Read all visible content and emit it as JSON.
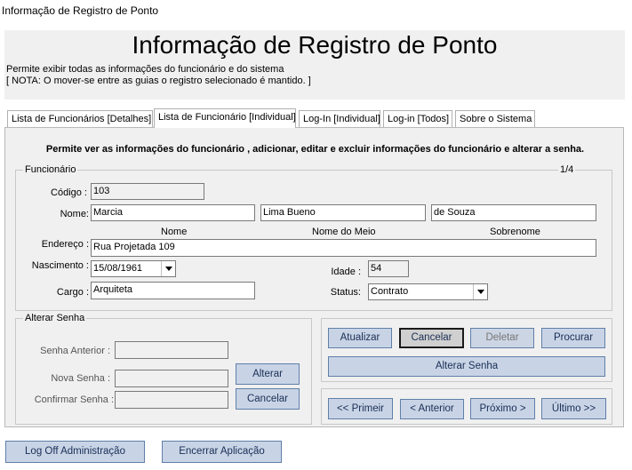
{
  "window": {
    "title": "Informação de Registro de Ponto"
  },
  "header": {
    "title": "Informação de Registro de Ponto",
    "line1": "Permite exibir todas as informações do funcionário e do sistema",
    "line2": "[ NOTA: O mover-se entre as guias o registro selecionado é mantido. ]"
  },
  "tabs": [
    {
      "label": "Lista de Funcionários [Detalhes]"
    },
    {
      "label": "Lista de Funcionário [Individual]"
    },
    {
      "label": "Log-In [Individual]"
    },
    {
      "label": "Log-in [Todos]"
    },
    {
      "label": "Sobre o Sistema"
    }
  ],
  "panel": {
    "intro": "Permite ver as informações do funcionário , adicionar, editar e excluir informações do funcionário e alterar a senha."
  },
  "employee": {
    "legend": "Funcionário",
    "counter": "1/4",
    "code_label": "Código :",
    "code": "103",
    "name_label": "Nome:",
    "first_name": "Marcia",
    "middle_name": "Lima Bueno",
    "last_name": "de Souza",
    "col_first": "Nome",
    "col_middle": "Nome do Meio",
    "col_last": "Sobrenome",
    "address_label": "Endereço :",
    "address": "Rua Projetada 109",
    "birth_label": "Nascimento :",
    "birth": "15/08/1961",
    "age_label": "Idade :",
    "age": "54",
    "role_label": "Cargo :",
    "role": "Arquiteta",
    "status_label": "Status:",
    "status": "Contrato"
  },
  "password": {
    "legend": "Alterar Senha",
    "old_label": "Senha Anterior :",
    "new_label": "Nova Senha :",
    "confirm_label": "Confirmar Senha :",
    "change_btn": "Alterar",
    "cancel_btn": "Cancelar"
  },
  "actions": {
    "update": "Atualizar",
    "cancel": "Cancelar",
    "delete": "Deletar",
    "search": "Procurar",
    "change_password": "Alterar Senha"
  },
  "nav": {
    "first": "<< Primeir",
    "prev": "< Anterior",
    "next": "Próximo >",
    "last": "Último >>"
  },
  "footer": {
    "logoff": "Log Off Administração",
    "exit": "Encerrar Aplicação"
  }
}
